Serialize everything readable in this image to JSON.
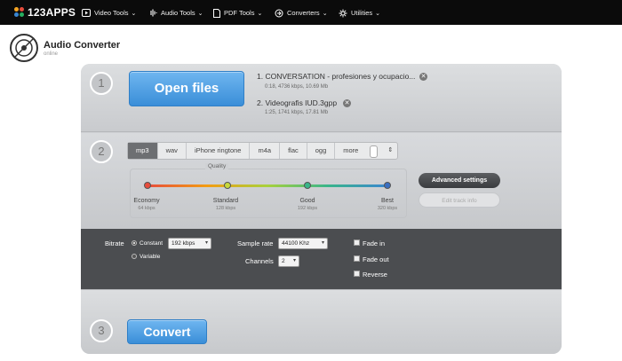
{
  "nav": {
    "logo": "123APPS",
    "items": [
      {
        "label": "Video Tools",
        "icon": "video-icon"
      },
      {
        "label": "Audio Tools",
        "icon": "audio-wave-icon"
      },
      {
        "label": "PDF Tools",
        "icon": "document-icon"
      },
      {
        "label": "Converters",
        "icon": "convert-icon"
      },
      {
        "label": "Utilities",
        "icon": "gear-icon"
      }
    ]
  },
  "header": {
    "title": "Audio Converter",
    "subtitle": "online"
  },
  "step1": {
    "number": "1",
    "open_label": "Open files",
    "files": [
      {
        "name": "1. CONVERSATION - profesiones y ocupacio...",
        "meta": "0:18, 4736 kbps, 10.69 Mb"
      },
      {
        "name": "2. Videografis IUD.3gpp",
        "meta": "1:25, 1741 kbps, 17.81 Mb"
      }
    ],
    "remove_glyph": "✕"
  },
  "step2": {
    "number": "2",
    "formats": [
      "mp3",
      "wav",
      "iPhone ringtone",
      "m4a",
      "flac",
      "ogg",
      "more"
    ],
    "active_format": "mp3",
    "quality_label": "Quality",
    "quality_levels": [
      {
        "name": "Economy",
        "kbps": "64 kbps"
      },
      {
        "name": "Standard",
        "kbps": "128 kbps"
      },
      {
        "name": "Good",
        "kbps": "192 kbps"
      },
      {
        "name": "Best",
        "kbps": "320 kbps"
      }
    ],
    "selected_quality": "Best",
    "advanced_label": "Advanced settings",
    "edit_label": "Edit track info"
  },
  "settings": {
    "bitrate_label": "Bitrate",
    "constant_label": "Constant",
    "variable_label": "Variable",
    "bitrate_value": "192 kbps",
    "sample_rate_label": "Sample rate",
    "sample_rate_value": "44100 Khz",
    "channels_label": "Channels",
    "channels_value": "2",
    "fade_in_label": "Fade in",
    "fade_out_label": "Fade out",
    "reverse_label": "Reverse"
  },
  "step3": {
    "number": "3",
    "convert_label": "Convert"
  },
  "colors": {
    "nav_bg": "#0b0b0b",
    "button_blue": "#3a8ed8",
    "settings_bg": "#4b4d50",
    "panel_bg": "#cfd1d4"
  }
}
